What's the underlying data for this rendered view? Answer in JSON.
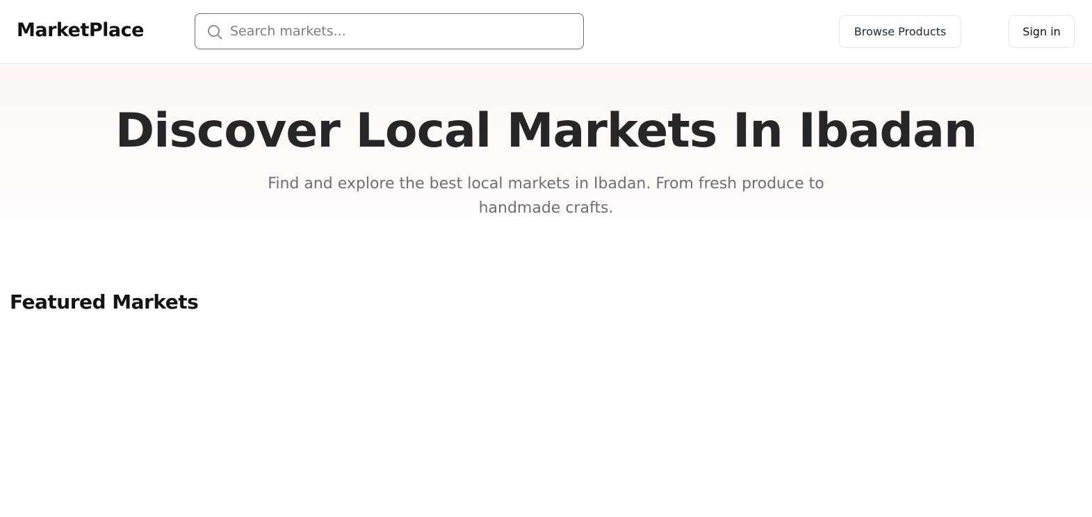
{
  "header": {
    "brand": "MarketPlace",
    "search": {
      "placeholder": "Search markets...",
      "value": "",
      "icon": "search-icon"
    },
    "browse_label": "Browse Products",
    "signin_label": "Sign in"
  },
  "hero": {
    "title": "Discover Local Markets In Ibadan",
    "subtitle": "Find and explore the best local markets in Ibadan. From fresh produce to handmade crafts."
  },
  "featured": {
    "title": "Featured Markets"
  },
  "colors": {
    "hero_background": "#fcf7f5",
    "text_primary": "#262628",
    "text_muted": "#6f6f73",
    "border": "#e3e6ea"
  }
}
